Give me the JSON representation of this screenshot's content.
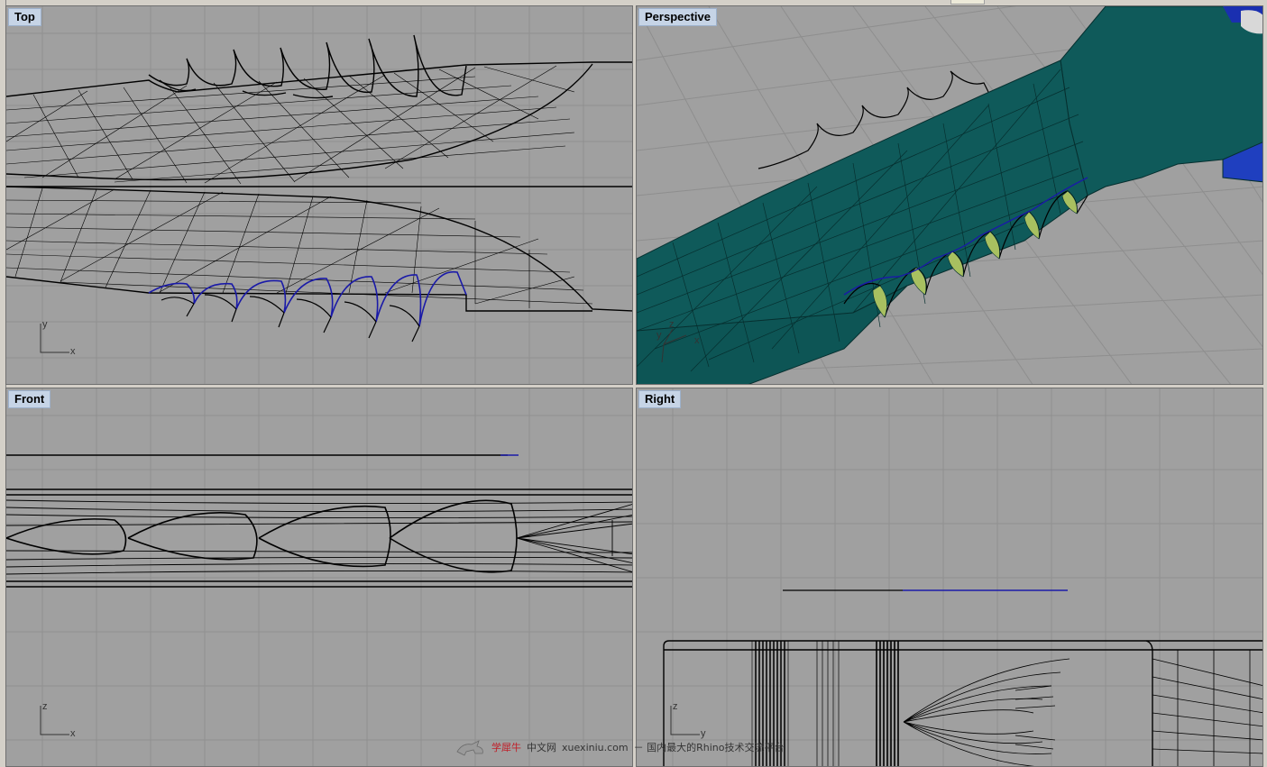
{
  "viewports": {
    "top": {
      "label": "Top"
    },
    "perspective": {
      "label": "Perspective"
    },
    "front": {
      "label": "Front"
    },
    "right": {
      "label": "Right"
    }
  },
  "axes": {
    "top": {
      "a": "y",
      "b": "x"
    },
    "perspective": {
      "a": "y",
      "b": "x",
      "c": "z"
    },
    "front": {
      "a": "z",
      "b": "x"
    },
    "right": {
      "a": "z",
      "b": "y"
    }
  },
  "watermark": {
    "brand": "学犀牛",
    "site_name": "中文网",
    "url": "xuexiniu.com",
    "tagline": "－ 国内最大的Rhino技术交流平台"
  },
  "colors": {
    "viewport_bg": "#a0a0a0",
    "grid": "#8f8f8f",
    "wire": "#000000",
    "selected_curve": "#1a1aa8",
    "surface": "#0f5a5a",
    "surface_edge": "#0a3a3a",
    "inner_surface": "#a8c060",
    "label_bg": "#c6d4e6"
  }
}
